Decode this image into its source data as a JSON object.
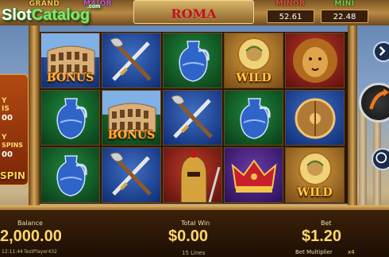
{
  "watermark": {
    "text_main": "Slot",
    "text_accent": "Catalog",
    "suffix": ".com"
  },
  "jackpots": [
    {
      "label": "GRAND",
      "value": "",
      "color": "#f2c44a"
    },
    {
      "label": "MAJOR",
      "value": "",
      "color": "#c05ad8"
    },
    {
      "label": "MINOR",
      "value": "52.61",
      "color": "#e0503a"
    },
    {
      "label": "MINI",
      "value": "22.48",
      "color": "#6bd24a"
    }
  ],
  "game_title": "ROMA",
  "promo_panel": {
    "line1": "Y",
    "line2": "IS",
    "line3": "00",
    "line4": "Y",
    "line5": "SPINS",
    "line6": "00",
    "spin_label": "SPIN"
  },
  "reels": [
    [
      {
        "symbol": "Colosseum",
        "label": "BONUS",
        "bg": "blue"
      },
      {
        "symbol": "Amphora",
        "label": "",
        "bg": "green"
      },
      {
        "symbol": "Amphora",
        "label": "",
        "bg": "green"
      }
    ],
    [
      {
        "symbol": "Axe and Sword",
        "label": "",
        "bg": "blue"
      },
      {
        "symbol": "Colosseum",
        "label": "BONUS",
        "bg": "green"
      },
      {
        "symbol": "Axe and Sword",
        "label": "",
        "bg": "blue"
      }
    ],
    [
      {
        "symbol": "Amphora",
        "label": "",
        "bg": "green"
      },
      {
        "symbol": "Axe and Sword",
        "label": "",
        "bg": "blue"
      },
      {
        "symbol": "Gladiator",
        "label": "",
        "bg": "red"
      }
    ],
    [
      {
        "symbol": "Caesar",
        "label": "WILD",
        "bg": "gold"
      },
      {
        "symbol": "Amphora",
        "label": "",
        "bg": "green"
      },
      {
        "symbol": "Crown",
        "label": "",
        "bg": "purple"
      }
    ],
    [
      {
        "symbol": "Lion",
        "label": "",
        "bg": "red"
      },
      {
        "symbol": "Shield",
        "label": "",
        "bg": "blue"
      },
      {
        "symbol": "Caesar",
        "label": "WILD",
        "bg": "gold"
      }
    ]
  ],
  "status": {
    "balance_label": "Balance",
    "balance_value": "2,000.00",
    "total_win_label": "Total Win",
    "total_win_value": "$0.00",
    "lines": "15 Lines",
    "bet_label": "Bet",
    "bet_value": "$1.20",
    "bet_multiplier_label": "Bet Multiplier",
    "bet_multiplier_value": "x4",
    "time": "12:11:44",
    "player": "TestPlayer432"
  },
  "icons": {
    "menu": "arrow-icon",
    "spin": "spin-icon",
    "autoplay": "autoplay-icon"
  }
}
